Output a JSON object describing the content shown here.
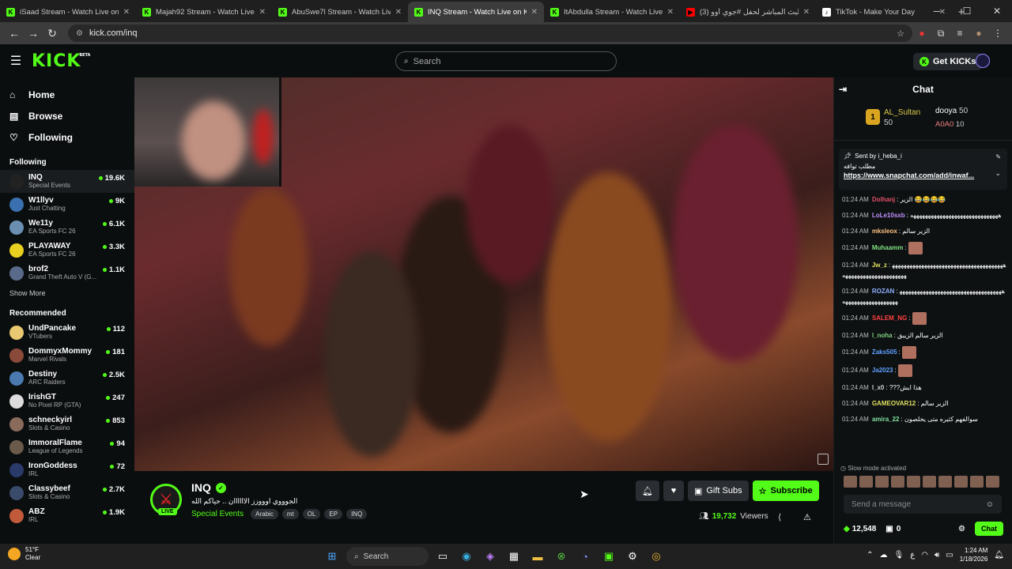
{
  "browser": {
    "tabs": [
      {
        "title": "iSaad Stream - Watch Live on K",
        "fav_color": "#53fc18",
        "fav_glyph": "K",
        "active": false
      },
      {
        "title": "Majah92 Stream - Watch Live o",
        "fav_color": "#53fc18",
        "fav_glyph": "K",
        "active": false
      },
      {
        "title": "AbuSwe7l Stream - Watch Live",
        "fav_color": "#53fc18",
        "fav_glyph": "K",
        "active": false
      },
      {
        "title": "INQ Stream - Watch Live on Ki",
        "fav_color": "#53fc18",
        "fav_glyph": "K",
        "active": true
      },
      {
        "title": "ItAbdulla Stream - Watch Live o",
        "fav_color": "#53fc18",
        "fav_glyph": "K",
        "active": false
      },
      {
        "title": "(3) البث المباشر لحفل #جوي أوو",
        "fav_color": "#ff0000",
        "fav_glyph": "▶",
        "active": false
      },
      {
        "title": "TikTok - Make Your Day",
        "fav_color": "#ffffff",
        "fav_glyph": "♪",
        "active": false
      }
    ],
    "url": "kick.com/inq"
  },
  "kick": {
    "logo": "KICK",
    "logo_sup": "BETA",
    "search_placeholder": "Search",
    "get_kicks": "Get KICKs",
    "brand_color": "#53fc18"
  },
  "sidebar": {
    "nav": [
      {
        "label": "Home",
        "icon": "home-icon",
        "glyph": "⌂"
      },
      {
        "label": "Browse",
        "icon": "browse-icon",
        "glyph": "▤"
      },
      {
        "label": "Following",
        "icon": "heart-icon",
        "glyph": "♡"
      }
    ],
    "following_header": "Following",
    "following": [
      {
        "name": "INQ",
        "game": "Special Events",
        "viewers": "19.6K",
        "color": "#222"
      },
      {
        "name": "W1llyv",
        "game": "Just Chatting",
        "viewers": "9K",
        "color": "#3a6fb0"
      },
      {
        "name": "We11y",
        "game": "EA Sports FC 26",
        "viewers": "6.1K",
        "color": "#6a8fb0"
      },
      {
        "name": "PLAYAWAY",
        "game": "EA Sports FC 26",
        "viewers": "3.3K",
        "color": "#e8d020"
      },
      {
        "name": "brof2",
        "game": "Grand Theft Auto V (G...",
        "viewers": "1.1K",
        "color": "#5a6a8a"
      }
    ],
    "show_more": "Show More",
    "recommended_header": "Recommended",
    "recommended": [
      {
        "name": "UndPancake",
        "game": "VTubers",
        "viewers": "112",
        "color": "#e8c870"
      },
      {
        "name": "DommyxMommy",
        "game": "Marvel Rivals",
        "viewers": "181",
        "color": "#8a4a3a"
      },
      {
        "name": "Destiny",
        "game": "ARC Raiders",
        "viewers": "2.5K",
        "color": "#4a7ab0"
      },
      {
        "name": "IrishGT",
        "game": "No Pixel RP (GTA)",
        "viewers": "247",
        "color": "#ddd"
      },
      {
        "name": "schneckyirl",
        "game": "Slots & Casino",
        "viewers": "853",
        "color": "#8a6a5a"
      },
      {
        "name": "ImmoralFlame",
        "game": "League of Legends",
        "viewers": "94",
        "color": "#6a5a4a"
      },
      {
        "name": "IronGoddess",
        "game": "IRL",
        "viewers": "72",
        "color": "#2a3a6a"
      },
      {
        "name": "Classybeef",
        "game": "Slots & Casino",
        "viewers": "2.7K",
        "color": "#3a4a6a"
      },
      {
        "name": "ABZ",
        "game": "IRL",
        "viewers": "1.9K",
        "color": "#c05a3a"
      }
    ]
  },
  "stream": {
    "name": "INQ",
    "title": "الجوووي اوووزز الاااااان .. حياكم الله",
    "category": "Special Events",
    "tags": [
      "Arabic",
      "mt",
      "OL",
      "EP",
      "INQ"
    ],
    "live_label": "LIVE",
    "gift_subs": "Gift Subs",
    "subscribe": "Subscribe",
    "viewers": "19,732",
    "viewers_label": "Viewers"
  },
  "chat": {
    "title": "Chat",
    "top_gifters": [
      {
        "rank": "1",
        "name": "AL_Sultan",
        "count": "50"
      },
      {
        "name": "dooya",
        "count": "50"
      },
      {
        "name": "A0A0",
        "count": "10"
      }
    ],
    "pinned": {
      "sent_by_label": "Sent by",
      "sender": "i_heba_i",
      "message": "مطلب توافه",
      "link": "https://www.snapchat.com/add/inwaf..."
    },
    "messages": [
      {
        "time": "01:24 AM",
        "user": "Dolhanj",
        "color": "#e0506a",
        "text": "الزير 😂😂😂😂"
      },
      {
        "time": "01:24 AM",
        "user": "LoLe10sxb",
        "color": "#c090ff",
        "text": "ههههههههههههههههههههههههههههههه"
      },
      {
        "time": "01:24 AM",
        "user": "mksleox",
        "color": "#ffc080",
        "text": "الزير سالم"
      },
      {
        "time": "01:24 AM",
        "user": "Muhaamm",
        "color": "#80e080",
        "text": "",
        "emote": true
      },
      {
        "time": "01:24 AM",
        "user": "Jw_z",
        "color": "#e0e060",
        "text": "ههههههههههههههههههههههههههههههههههههههههههههههههههههههههههههه"
      },
      {
        "time": "01:24 AM",
        "user": "ROZAN",
        "color": "#8fb0ff",
        "text": "ههههههههههههههههههههههههههههههههههههههههههههههههههههههه"
      },
      {
        "time": "01:24 AM",
        "user": "SALEM_NG",
        "color": "#ff4040",
        "text": "",
        "emote": true
      },
      {
        "time": "01:24 AM",
        "user": "l_noha",
        "color": "#80d080",
        "text": "الزير سالم الزيبق"
      },
      {
        "time": "01:24 AM",
        "user": "Zaks505",
        "color": "#60a0ff",
        "text": "",
        "emote": true
      },
      {
        "time": "01:24 AM",
        "user": "Ja2023",
        "color": "#60a0ff",
        "text": "",
        "emote": true
      },
      {
        "time": "01:24 AM",
        "user": "l_x0",
        "color": "#d0d0d0",
        "text": "???هذا ايش"
      },
      {
        "time": "01:24 AM",
        "user": "GAMEOVAR12",
        "color": "#e0e060",
        "text": "الزير سالم"
      },
      {
        "time": "01:24 AM",
        "user": "amira_22",
        "color": "#80e0a0",
        "text": "سوالفهم كثيره متى يخلصون"
      }
    ],
    "slow_mode": "Slow mode activated",
    "input_placeholder": "Send a message",
    "kicks_balance": "12,548",
    "gifts": "0",
    "send": "Chat"
  },
  "taskbar": {
    "temp": "51°F",
    "weather": "Clear",
    "search": "Search",
    "time": "1:24 AM",
    "date": "1/18/2026"
  }
}
